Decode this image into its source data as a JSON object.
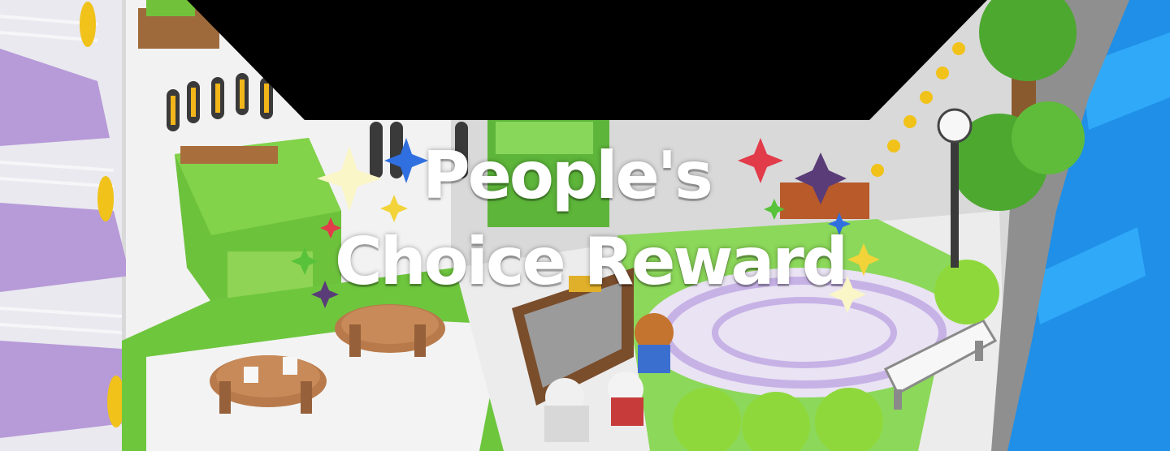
{
  "banner": {
    "title_line_1": "People's",
    "title_line_2": "Choice Reward"
  },
  "colors": {
    "sky_black": "#000000",
    "grass": "#7ccf3a",
    "grass_dark": "#4fa12a",
    "stone": "#e8e8e8",
    "purple_floor": "#b89ad6",
    "water": "#1f8fe8",
    "wood": "#b87a4b",
    "sparkle_blue": "#2f6fe0",
    "sparkle_red": "#e23b4a",
    "sparkle_yellow": "#f2d33a",
    "sparkle_green": "#58c23a",
    "sparkle_purple": "#5a3d78",
    "sparkle_cream": "#fbf6c8"
  },
  "icons": [
    "sparkle-icon",
    "tree-icon",
    "lamp-post-icon",
    "bench-icon",
    "table-icon",
    "signboard-icon",
    "character-icon"
  ]
}
